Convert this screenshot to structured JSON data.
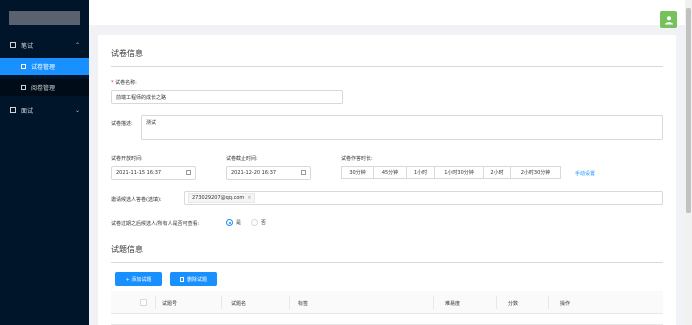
{
  "sidebar": {
    "groups": [
      {
        "label": "笔试",
        "icon": "grid-icon",
        "expanded": true,
        "items": [
          {
            "label": "试卷管理",
            "active": true
          },
          {
            "label": "阅卷管理",
            "active": false
          }
        ]
      },
      {
        "label": "面试",
        "icon": "user-icon",
        "expanded": false
      }
    ]
  },
  "form": {
    "section_title": "试卷信息",
    "name_label": "试卷名称:",
    "name_value": "前端工程师的成长之路",
    "desc_label": "试卷描述:",
    "desc_value": "测试",
    "start_label": "试卷开放时间:",
    "start_value": "2021-11-15 16:37",
    "end_label": "试卷截止时间:",
    "end_value": "2021-12-20 16:37",
    "duration_label": "试卷作答时长:",
    "durations": [
      "30分钟",
      "45分钟",
      "1小时",
      "1小时30分钟",
      "2小时",
      "2小时30分钟"
    ],
    "manual_set": "手动设置",
    "invite_label": "邀请候选人答卷(选填):",
    "invite_tag": "273029207@qq.com",
    "invite_tag_close": "×",
    "visible_label": "试卷过期之后候选人/所有人是否可查看:",
    "visible_yes": "是",
    "visible_no": "否",
    "visible_selected": "是"
  },
  "questions": {
    "section_title": "试题信息",
    "add_button": "+ 添加试题",
    "delete_button": "删除试题",
    "columns": [
      "试题号",
      "试题名",
      "标签",
      "难易度",
      "分数",
      "操作"
    ]
  },
  "colors": {
    "sidebar_bg": "#001529",
    "accent": "#1890ff",
    "avatar": "#77c15b"
  }
}
